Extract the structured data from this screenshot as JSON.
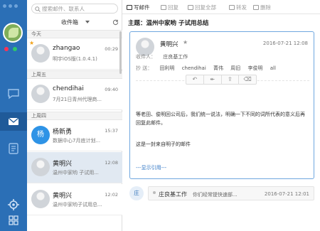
{
  "sidebar": {
    "nav": [
      {
        "icon": "chat-bubble-icon"
      },
      {
        "icon": "mail-icon"
      },
      {
        "icon": "notebook-icon"
      }
    ],
    "bottom": [
      {
        "icon": "settings-icon"
      },
      {
        "icon": "grid-icon"
      }
    ],
    "colors": {
      "rail": "#2b6fb6",
      "selected": "#1f5a99"
    }
  },
  "mail_list": {
    "search_placeholder": "搜索邮件、联系人",
    "folder": "收件箱",
    "groups": [
      {
        "label": "今天",
        "items": [
          {
            "name": "zhangao",
            "time": "00:29",
            "preview": "明宇iOS版(1.0.4.1)",
            "starred": true
          }
        ]
      },
      {
        "label": "上周五",
        "items": [
          {
            "name": "chendihai",
            "time": "09:40",
            "preview": "7月21日青州代理商..."
          }
        ]
      },
      {
        "label": "上周四",
        "items": [
          {
            "name": "杨新勇",
            "avatar_text": "杨",
            "time": "15:37",
            "preview": "数据中心7月底计划..."
          },
          {
            "name": "黄明兴",
            "time": "12:08",
            "preview": "温州中家哟 子试用...",
            "selected": true
          },
          {
            "name": "黄明兴",
            "time": "12:02",
            "preview": "温州中家哟子试用总..."
          }
        ]
      }
    ]
  },
  "toolbar": {
    "write": "写邮件",
    "reply": "回复",
    "reply_all": "回复全部",
    "forward": "转发",
    "delete": "删除"
  },
  "reader": {
    "subject": "主题：温州中家哟 子试用总结",
    "from": "黄明兴",
    "date": "2016-07-21 12:08",
    "to_label": "收件人：",
    "to": "庄良基工作",
    "cc_label": "抄 送：",
    "cc": [
      "田利明",
      "chendihai",
      "菁伟",
      "周旧",
      "李俊明",
      "all"
    ],
    "body_p1": "等老田、俊明回公司后，我们统一说法，明确一下不同的词所代表的意义后再回复此邮件。",
    "body_p2": "这是一封来自明子的邮件",
    "quote_link": "---显示引用---",
    "reply_row": {
      "avatar": "庄",
      "name": "庄良基工作",
      "text": "你们经常提快速部...",
      "date": "2016-07-21 12:01"
    }
  }
}
